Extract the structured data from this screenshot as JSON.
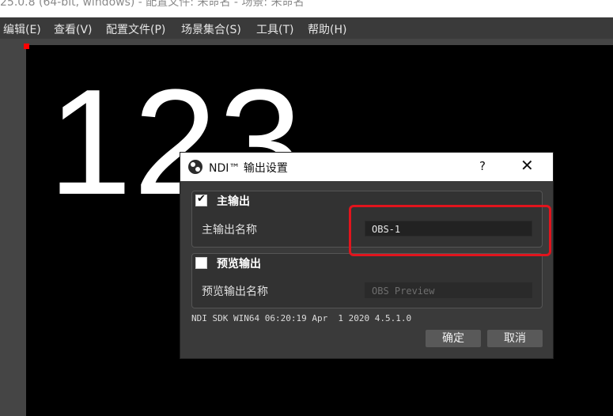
{
  "window": {
    "title": "25.0.8 (64-bit, windows) - 配置文件: 未命名 - 场景: 未命名"
  },
  "menu": {
    "items": [
      "编辑(E)",
      "查看(V)",
      "配置文件(P)",
      "场景集合(S)",
      "工具(T)",
      "帮助(H)"
    ]
  },
  "canvas": {
    "text": "123",
    "background": "#000000"
  },
  "dialog": {
    "title": "NDI™ 输出设置",
    "help_label": "?",
    "close_label": "✕",
    "main_output": {
      "checked": true,
      "title": "主输出",
      "name_label": "主输出名称",
      "name_value": "OBS-1"
    },
    "preview_output": {
      "checked": false,
      "title": "预览输出",
      "name_label": "预览输出名称",
      "name_placeholder": "OBS Preview"
    },
    "sdk_info": "NDI SDK WIN64 06:20:19 Apr  1 2020 4.5.1.0",
    "ok_label": "确定",
    "cancel_label": "取消"
  },
  "colors": {
    "highlight": "#e1141d",
    "accent": "#ff0000"
  },
  "icons": {
    "dialog_logo": "obs-logo-icon",
    "checkmark": "check-icon"
  }
}
